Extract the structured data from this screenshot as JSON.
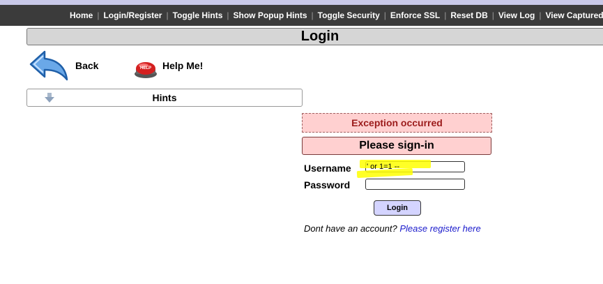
{
  "nav": {
    "items": [
      "Home",
      "Login/Register",
      "Toggle Hints",
      "Show Popup Hints",
      "Toggle Security",
      "Enforce SSL",
      "Reset DB",
      "View Log",
      "View Captured"
    ],
    "separator": "|"
  },
  "page_title": "Login",
  "back_label": "Back",
  "help_label": "Help Me!",
  "help_icon_text": "HELP",
  "hints_label": "Hints",
  "form": {
    "exception": "Exception occurred",
    "heading": "Please sign-in",
    "username_label": "Username",
    "username_value": "' or 1=1 --",
    "password_label": "Password",
    "password_value": "",
    "login_button": "Login",
    "register_prompt": "Dont have an account?",
    "register_link": "Please register here"
  },
  "colors": {
    "nav_bg": "#3b3b3b",
    "exception_bg": "#ffd0d0",
    "exception_text": "#9b1b1b",
    "highlight": "#ffff00",
    "link": "#1a1acc",
    "login_button_bg": "#d4d4ff"
  }
}
